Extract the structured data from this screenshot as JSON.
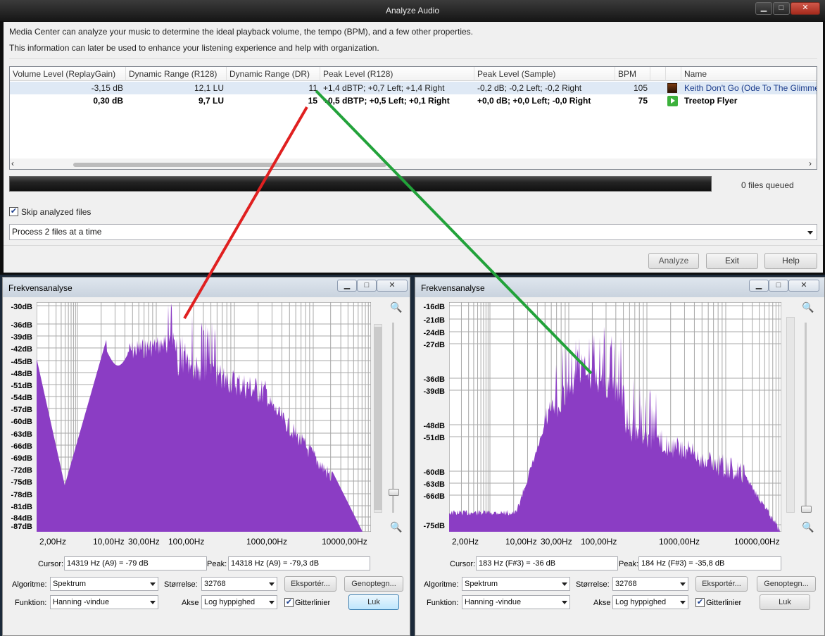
{
  "top_window": {
    "title": "Analyze Audio",
    "description_line1": "Media Center can analyze your music to determine the ideal playback volume, the tempo (BPM), and a few other properties.",
    "description_line2": "This information can later be used to enhance your listening experience and help with organization.",
    "columns": [
      "Volume Level (ReplayGain)",
      "Dynamic Range (R128)",
      "Dynamic Range (DR)",
      "Peak Level (R128)",
      "Peak Level (Sample)",
      "BPM",
      "Name"
    ],
    "rows": [
      {
        "replaygain": "-3,15 dB",
        "dr_r128": "12,1 LU",
        "dr": "11",
        "peak_r128": "+1,4 dBTP; +0,7 Left; +1,4 Right",
        "peak_sample": "-0,2 dB; -0,2 Left; -0,2 Right",
        "bpm": "105",
        "name": "Keith Don't Go (Ode To The Glimme"
      },
      {
        "replaygain": "0,30 dB",
        "dr_r128": "9,7 LU",
        "dr": "15",
        "peak_r128": "+0,5 dBTP; +0,5 Left; +0,1 Right",
        "peak_sample": "+0,0 dB; +0,0 Left; -0,0 Right",
        "bpm": "75",
        "name": "Treetop Flyer"
      }
    ],
    "scroll_left": "‹",
    "scroll_right": "›",
    "queue_status": "0 files queued",
    "skip_label": "Skip analyzed files",
    "skip_checked": true,
    "process_select": "Process 2 files at a time",
    "buttons": {
      "analyze": "Analyze",
      "exit": "Exit",
      "help": "Help"
    },
    "window_buttons": {
      "minimize": "▁",
      "maximize": "□",
      "close": "✕"
    }
  },
  "analyzers": [
    {
      "title": "Frekvensanalyse",
      "y_labels": [
        "-30dB",
        "-36dB",
        "-39dB",
        "-42dB",
        "-45dB",
        "-48dB",
        "-51dB",
        "-54dB",
        "-57dB",
        "-60dB",
        "-63dB",
        "-66dB",
        "-69dB",
        "-72dB",
        "-75dB",
        "-78dB",
        "-81dB",
        "-84dB",
        "-87dB"
      ],
      "x_labels": [
        "2,00Hz",
        "10,00Hz",
        "30,00Hz",
        "100,00Hz",
        "1000,00Hz",
        "10000,00Hz"
      ],
      "cursor_label": "Cursor:",
      "cursor_value": "14319 Hz (A9) = -79 dB",
      "peak_label": "Peak:",
      "peak_value": "14318 Hz (A9) = -79,3 dB",
      "algorithm_label": "Algoritme:",
      "algorithm": "Spektrum",
      "size_label": "Størrelse:",
      "size": "32768",
      "export_button": "Eksportér...",
      "replot_button": "Genoptegn...",
      "function_label": "Funktion:",
      "function": "Hanning -vindue",
      "axis_label": "Akse",
      "axis": "Log hyppighed",
      "gridlines_label": "Gitterlinier",
      "gridlines_checked": true,
      "close_button": "Luk"
    },
    {
      "title": "Frekvensanalyse",
      "y_labels": [
        "-16dB",
        "-21dB",
        "-24dB",
        "-27dB",
        "-36dB",
        "-39dB",
        "-48dB",
        "-51dB",
        "-60dB",
        "-63dB",
        "-66dB",
        "-75dB"
      ],
      "x_labels": [
        "2,00Hz",
        "10,00Hz",
        "30,00Hz",
        "100,00Hz",
        "1000,00Hz",
        "10000,00Hz"
      ],
      "cursor_label": "Cursor:",
      "cursor_value": "183 Hz (F#3) = -36 dB",
      "peak_label": "Peak:",
      "peak_value": "184 Hz (F#3) = -35,8 dB",
      "algorithm_label": "Algoritme:",
      "algorithm": "Spektrum",
      "size_label": "Størrelse:",
      "size": "32768",
      "export_button": "Eksportér...",
      "replot_button": "Genoptegn...",
      "function_label": "Funktion:",
      "function": "Hanning -vindue",
      "axis_label": "Akse",
      "axis": "Log hyppighed",
      "gridlines_label": "Gitterlinier",
      "gridlines_checked": true,
      "close_button": "Luk"
    }
  ],
  "colors": {
    "spectrum": "#8b3dc4",
    "red_line": "#e02020",
    "green_line": "#22a23a",
    "dark_titlebar": "#1a1a1a"
  }
}
